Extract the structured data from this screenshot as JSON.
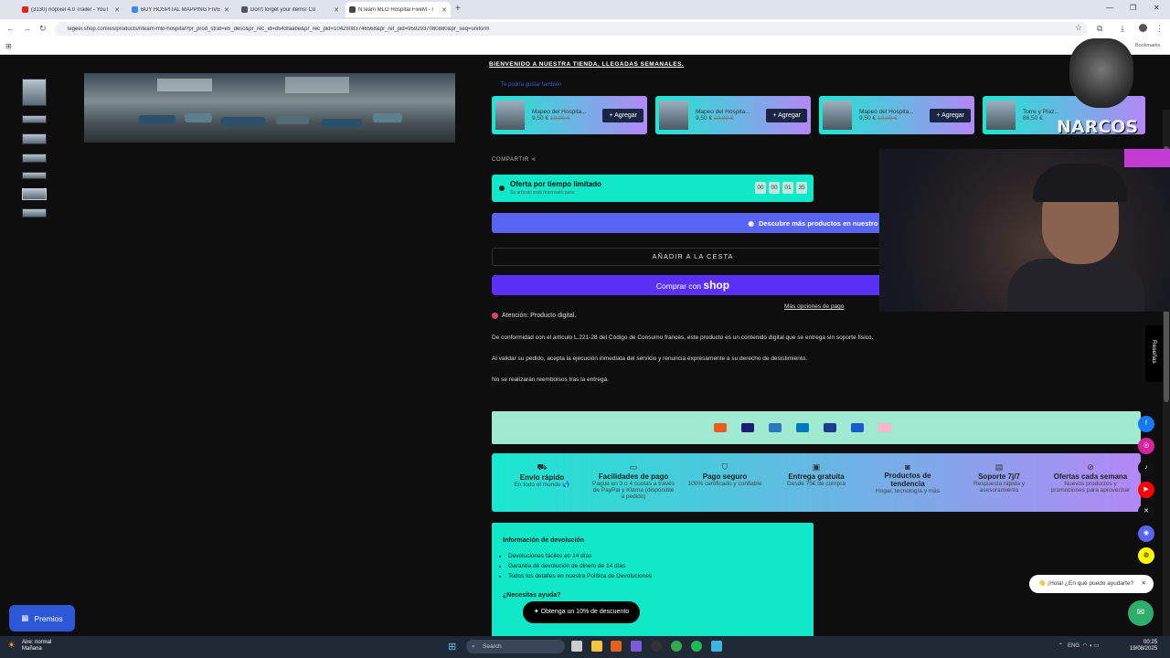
{
  "browser": {
    "tabs": [
      {
        "title": "(3130) nopixel 4.0 Trailer - YouT",
        "color": "#e62117"
      },
      {
        "title": "BUY HOSPITAL MAPPING FIVE",
        "color": "#4285f4"
      },
      {
        "title": "Don't forget your items! Co",
        "color": "#555555"
      },
      {
        "title": "NTeam MLO Hospital FiveM - l",
        "color": "#444444"
      }
    ],
    "url": "legeei.shop.com/es/products/nteam-mlo-hospital?pr_prod_strat=e5_desc&pr_rec_id=d543faabe&pr_rec_pid=10429083746568&pr_ref_pid=9592937080880&pr_seq=uniform",
    "bookmarks_label": "Bookmarks"
  },
  "store": {
    "welcome": "BIENVENIDO A NUESTRA TIENDA, LLEGADAS SEMANALES.",
    "recently_viewed": "Te podría gustar también",
    "cards": [
      {
        "name": "Mapeo del Hospita...",
        "price": "9,50 €",
        "old_price": "10,00 €",
        "button": "+ Agregar"
      },
      {
        "name": "Mapeo del Hospita...",
        "price": "9,50 €",
        "old_price": "10,00 €",
        "button": "+ Agregar"
      },
      {
        "name": "Mapeo del Hospita...",
        "price": "9,50 €",
        "old_price": "10,00 €",
        "button": "+ Agregar"
      },
      {
        "name": "Torre y Plaz...",
        "price": "88,50 €",
        "old_price": "",
        "button": "+ Agregar"
      }
    ],
    "share": "COMPARTIR",
    "offer": {
      "title": "Oferta por tiempo limitado",
      "subtitle": "Su artículo está reservado para",
      "countdown": [
        "00",
        "00",
        "01",
        "35"
      ]
    },
    "discord_button": "Descubre más productos en nuestro Di",
    "add_to_cart": "AÑADIR A LA CESTA",
    "buy_with": "Comprar con",
    "shop_brand": "shop",
    "more_options": "Más opciones de pago",
    "attention": "Atención: Producto digital.",
    "paragraphs": [
      "De conformidad con el artículo L.221-28 del Código de Consumo francés, este producto es un contenido digital que se entrega sin soporte físico.",
      "Al validar su pedido, acepta la ejecución inmediata del servicio y renuncia expresamente a su derecho de desistimiento.",
      "No se realizarán reembolsos tras la entrega."
    ],
    "payments": [
      {
        "name": "Mastercard",
        "color": "#eb5a1f"
      },
      {
        "name": "VISA",
        "color": "#1a1f71"
      },
      {
        "name": "AMEX",
        "color": "#2e77bb"
      },
      {
        "name": "Diners",
        "color": "#0079be"
      },
      {
        "name": "PayPal",
        "color": "#1a3f8f"
      },
      {
        "name": "Maestro",
        "color": "#1a5ad0"
      },
      {
        "name": "Klarna",
        "color": "#ffb3c7"
      }
    ],
    "features": [
      {
        "title": "Envío rápido",
        "sub": "En todo el mundo 🌎"
      },
      {
        "title": "Facilidades de pago",
        "sub": "Pague en 3 o 4 cuotas a través de PayPal y Klarna (disponible a pedido)"
      },
      {
        "title": "Pago seguro",
        "sub": "100% certificado y confiable"
      },
      {
        "title": "Entrega gratuita",
        "sub": "Desde 75€ de compra"
      },
      {
        "title": "Productos de tendencia",
        "sub": "Hogar, tecnología y más"
      },
      {
        "title": "Soporte 7j/7",
        "sub": "Respuesta rápida y asesoramiento"
      },
      {
        "title": "Ofertas cada semana",
        "sub": "Nuevos productos y promociones para aprovechar"
      }
    ],
    "returns": {
      "title": "Información de devolución",
      "items": [
        "Devoluciones fáciles en 14 días",
        "Garantía de devolución de dinero de 14 días",
        "Todos los detalles en nuestra Política de Devoluciones"
      ],
      "help_title": "¿Necesitas ayuda?"
    },
    "discount": "Obtenga un 10% de descuento",
    "rewards": "Premios",
    "reviews_tab": "Reseñas",
    "chat_greeting": "👋 ¡Hola! ¿En qué puedo ayudarte?"
  },
  "social": [
    {
      "name": "facebook",
      "color": "#1877f2"
    },
    {
      "name": "instagram",
      "color": "#d6249f"
    },
    {
      "name": "tiktok",
      "color": "#111111"
    },
    {
      "name": "youtube",
      "color": "#ff0000"
    },
    {
      "name": "x",
      "color": "#111111"
    },
    {
      "name": "discord",
      "color": "#5865f2"
    },
    {
      "name": "snapchat",
      "color": "#fffc00"
    }
  ],
  "overlay": {
    "brand": "NARCOS"
  },
  "taskbar": {
    "weather_line1": "Aire: normal",
    "weather_line2": "Mañana",
    "search": "Search",
    "lang": "ENG",
    "time": "00:25",
    "date": "19/08/2025"
  }
}
